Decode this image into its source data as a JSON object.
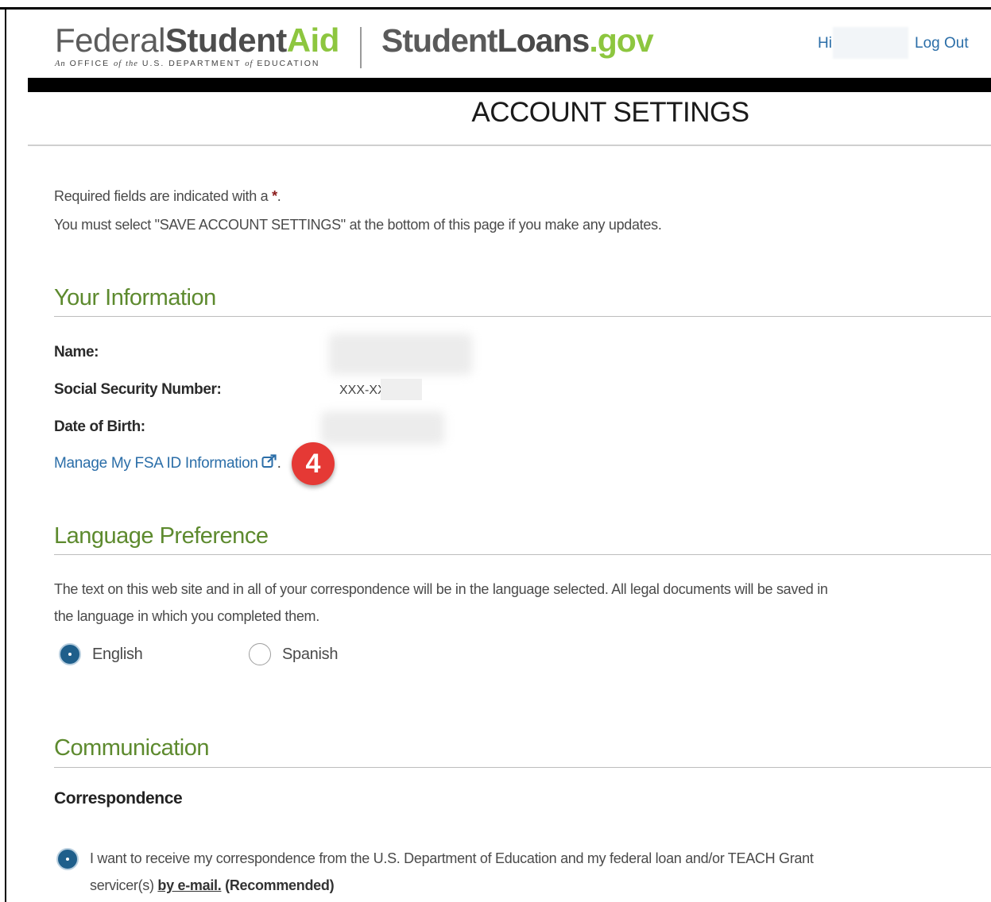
{
  "header": {
    "logo_fsa": {
      "federal": "Federal",
      "student": "Student",
      "aid": "Aid",
      "sub_an": "An",
      "sub_office": "OFFICE",
      "sub_of1": "of",
      "sub_the": "the",
      "sub_dept": "U.S. DEPARTMENT",
      "sub_of2": "of",
      "sub_edu": "EDUCATION"
    },
    "logo_sl": {
      "student": "Student",
      "loans": "Loans",
      "gov": ".gov"
    },
    "greeting": "Hi",
    "logout": "Log Out"
  },
  "page_title": "ACCOUNT SETTINGS",
  "intro": {
    "required_text": "Required fields are indicated with a",
    "required_star": "*",
    "required_end": ".",
    "save_note": "You must select \"SAVE ACCOUNT SETTINGS\" at the bottom of this page if you make any updates."
  },
  "your_information": {
    "heading": "Your Information",
    "name_label": "Name:",
    "ssn_label": "Social Security Number:",
    "ssn_prefix": "XXX-XX-",
    "dob_label": "Date of Birth:",
    "manage_link": "Manage My FSA ID Information",
    "manage_link_end": "."
  },
  "callout_badge": "4",
  "language": {
    "heading": "Language Preference",
    "desc_line1": "The text on this web site and in all of your correspondence will be in the language selected. All legal documents will be saved in",
    "desc_line2": "the language in which you completed them.",
    "options": [
      {
        "label": "English",
        "selected": true
      },
      {
        "label": "Spanish",
        "selected": false
      }
    ]
  },
  "communication": {
    "heading": "Communication",
    "subheading": "Correspondence",
    "option1_line1": "I want to receive my correspondence from the U.S. Department of Education and my federal loan and/or TEACH Grant",
    "option1_line2_pre": "servicer(s)",
    "option1_link": "by e-mail.",
    "option1_rec": "(Recommended)",
    "option1_selected": true
  },
  "colors": {
    "link_blue": "#2b6ea8",
    "section_green": "#5d8a2e",
    "logo_green": "#8dc63f",
    "radio_selected": "#1f5f8b",
    "badge_red": "#e53935"
  }
}
